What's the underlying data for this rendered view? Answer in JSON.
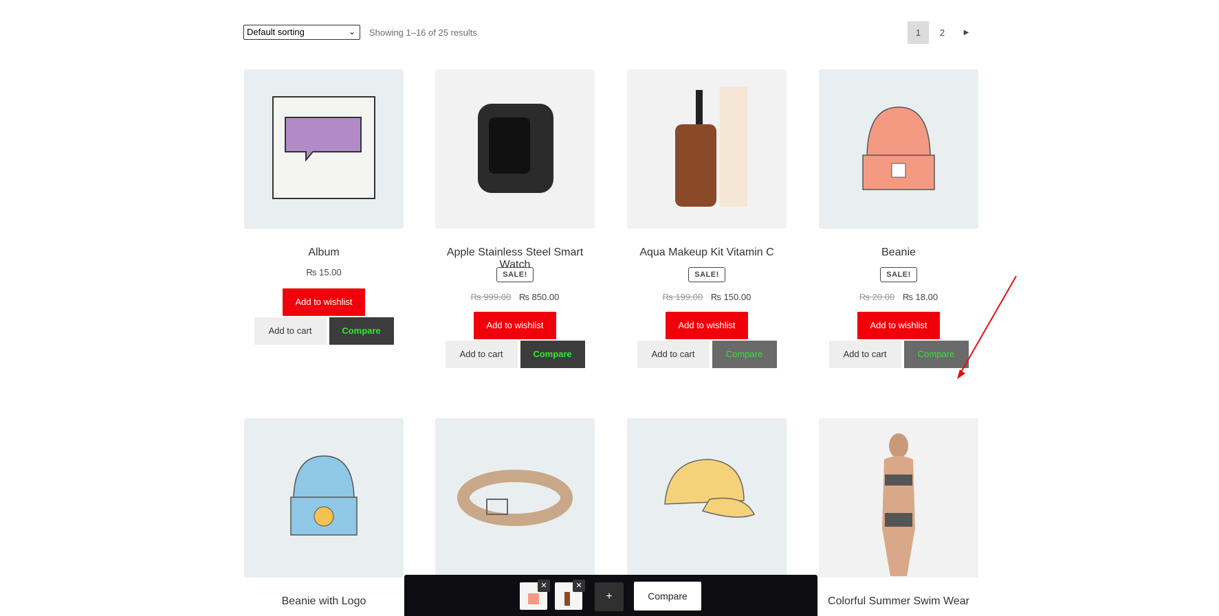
{
  "toolbar": {
    "sort_value": "Default sorting",
    "result_count": "Showing 1–16 of 25 results",
    "pages": [
      "1",
      "2"
    ],
    "current_page": "1"
  },
  "products": [
    {
      "title": "Album",
      "price": "₨ 15.00",
      "sale": false,
      "wishlist": "Add to wishlist",
      "cart": "Add to cart",
      "compare": "Compare"
    },
    {
      "title": "Apple Stainless Steel Smart Watch",
      "sale_label": "SALE!",
      "price_old": "₨ 999.00",
      "price_new": "₨ 850.00",
      "wishlist": "Add to wishlist",
      "cart": "Add to cart",
      "compare": "Compare"
    },
    {
      "title": "Aqua Makeup Kit Vitamin C",
      "sale_label": "SALE!",
      "price_old": "₨ 199.00",
      "price_new": "₨ 150.00",
      "wishlist": "Add to wishlist",
      "cart": "Add to cart",
      "compare": "Compare"
    },
    {
      "title": "Beanie",
      "sale_label": "SALE!",
      "price_old": "₨ 20.00",
      "price_new": "₨ 18.00",
      "wishlist": "Add to wishlist",
      "cart": "Add to cart",
      "compare": "Compare"
    },
    {
      "title": "Beanie with Logo"
    },
    {
      "title": ""
    },
    {
      "title": ""
    },
    {
      "title": "Colorful Summer Swim Wear"
    }
  ],
  "compare_bar": {
    "add_label": "+",
    "remove_label": "✕",
    "compare_label": "Compare"
  },
  "colors": {
    "wishlist_bg": "#f0000a",
    "compare_text": "#33e633",
    "annotation_arrow": "#e01010"
  }
}
